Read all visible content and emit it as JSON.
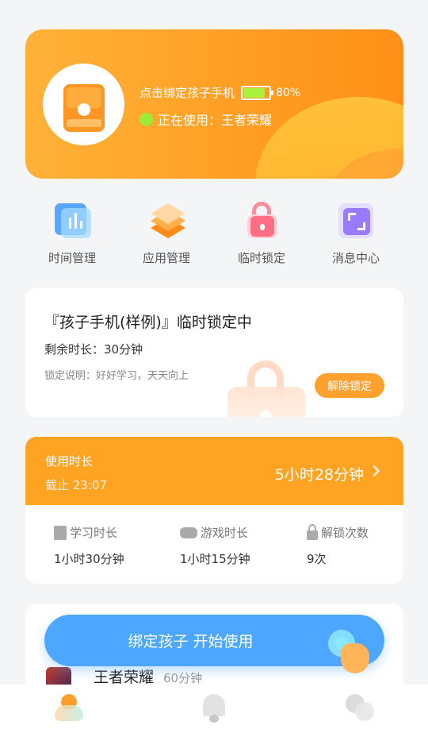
{
  "hero": {
    "bind_text": "点击绑定孩子手机",
    "battery_level": 0.8,
    "battery_percent": "80%",
    "using_text": "正在使用：王者荣耀",
    "colors": {
      "accent": "#ff9f24",
      "status_green": "#9dea3a"
    }
  },
  "menu": {
    "items": [
      {
        "label": "时间管理",
        "icon": "bar-chart-icon"
      },
      {
        "label": "应用管理",
        "icon": "layers-icon"
      },
      {
        "label": "临时锁定",
        "icon": "padlock-icon"
      },
      {
        "label": "消息中心",
        "icon": "expand-frame-icon"
      }
    ]
  },
  "lock_card": {
    "title": "『孩子手机(样例)』临时锁定中",
    "remaining": "剩余时长：30分钟",
    "note": "锁定说明：好好学习，天天向上",
    "button": "解除锁定"
  },
  "usage": {
    "heading": "使用时长",
    "deadline": "截止 23:07",
    "total": "5小时28分钟",
    "stats": [
      {
        "label": "学习时长",
        "value": "1小时30分钟",
        "icon": "book-icon"
      },
      {
        "label": "游戏时长",
        "value": "1小时15分钟",
        "icon": "gamepad-icon"
      },
      {
        "label": "解锁次数",
        "value": "9次",
        "icon": "lock-icon"
      }
    ]
  },
  "apps": {
    "items": [
      {
        "name": "王者荣耀",
        "duration": "60分钟"
      }
    ]
  },
  "bind_button": {
    "label": "绑定孩子 开始使用"
  },
  "tabbar": {
    "tabs": [
      "home",
      "notifications",
      "profile"
    ]
  }
}
